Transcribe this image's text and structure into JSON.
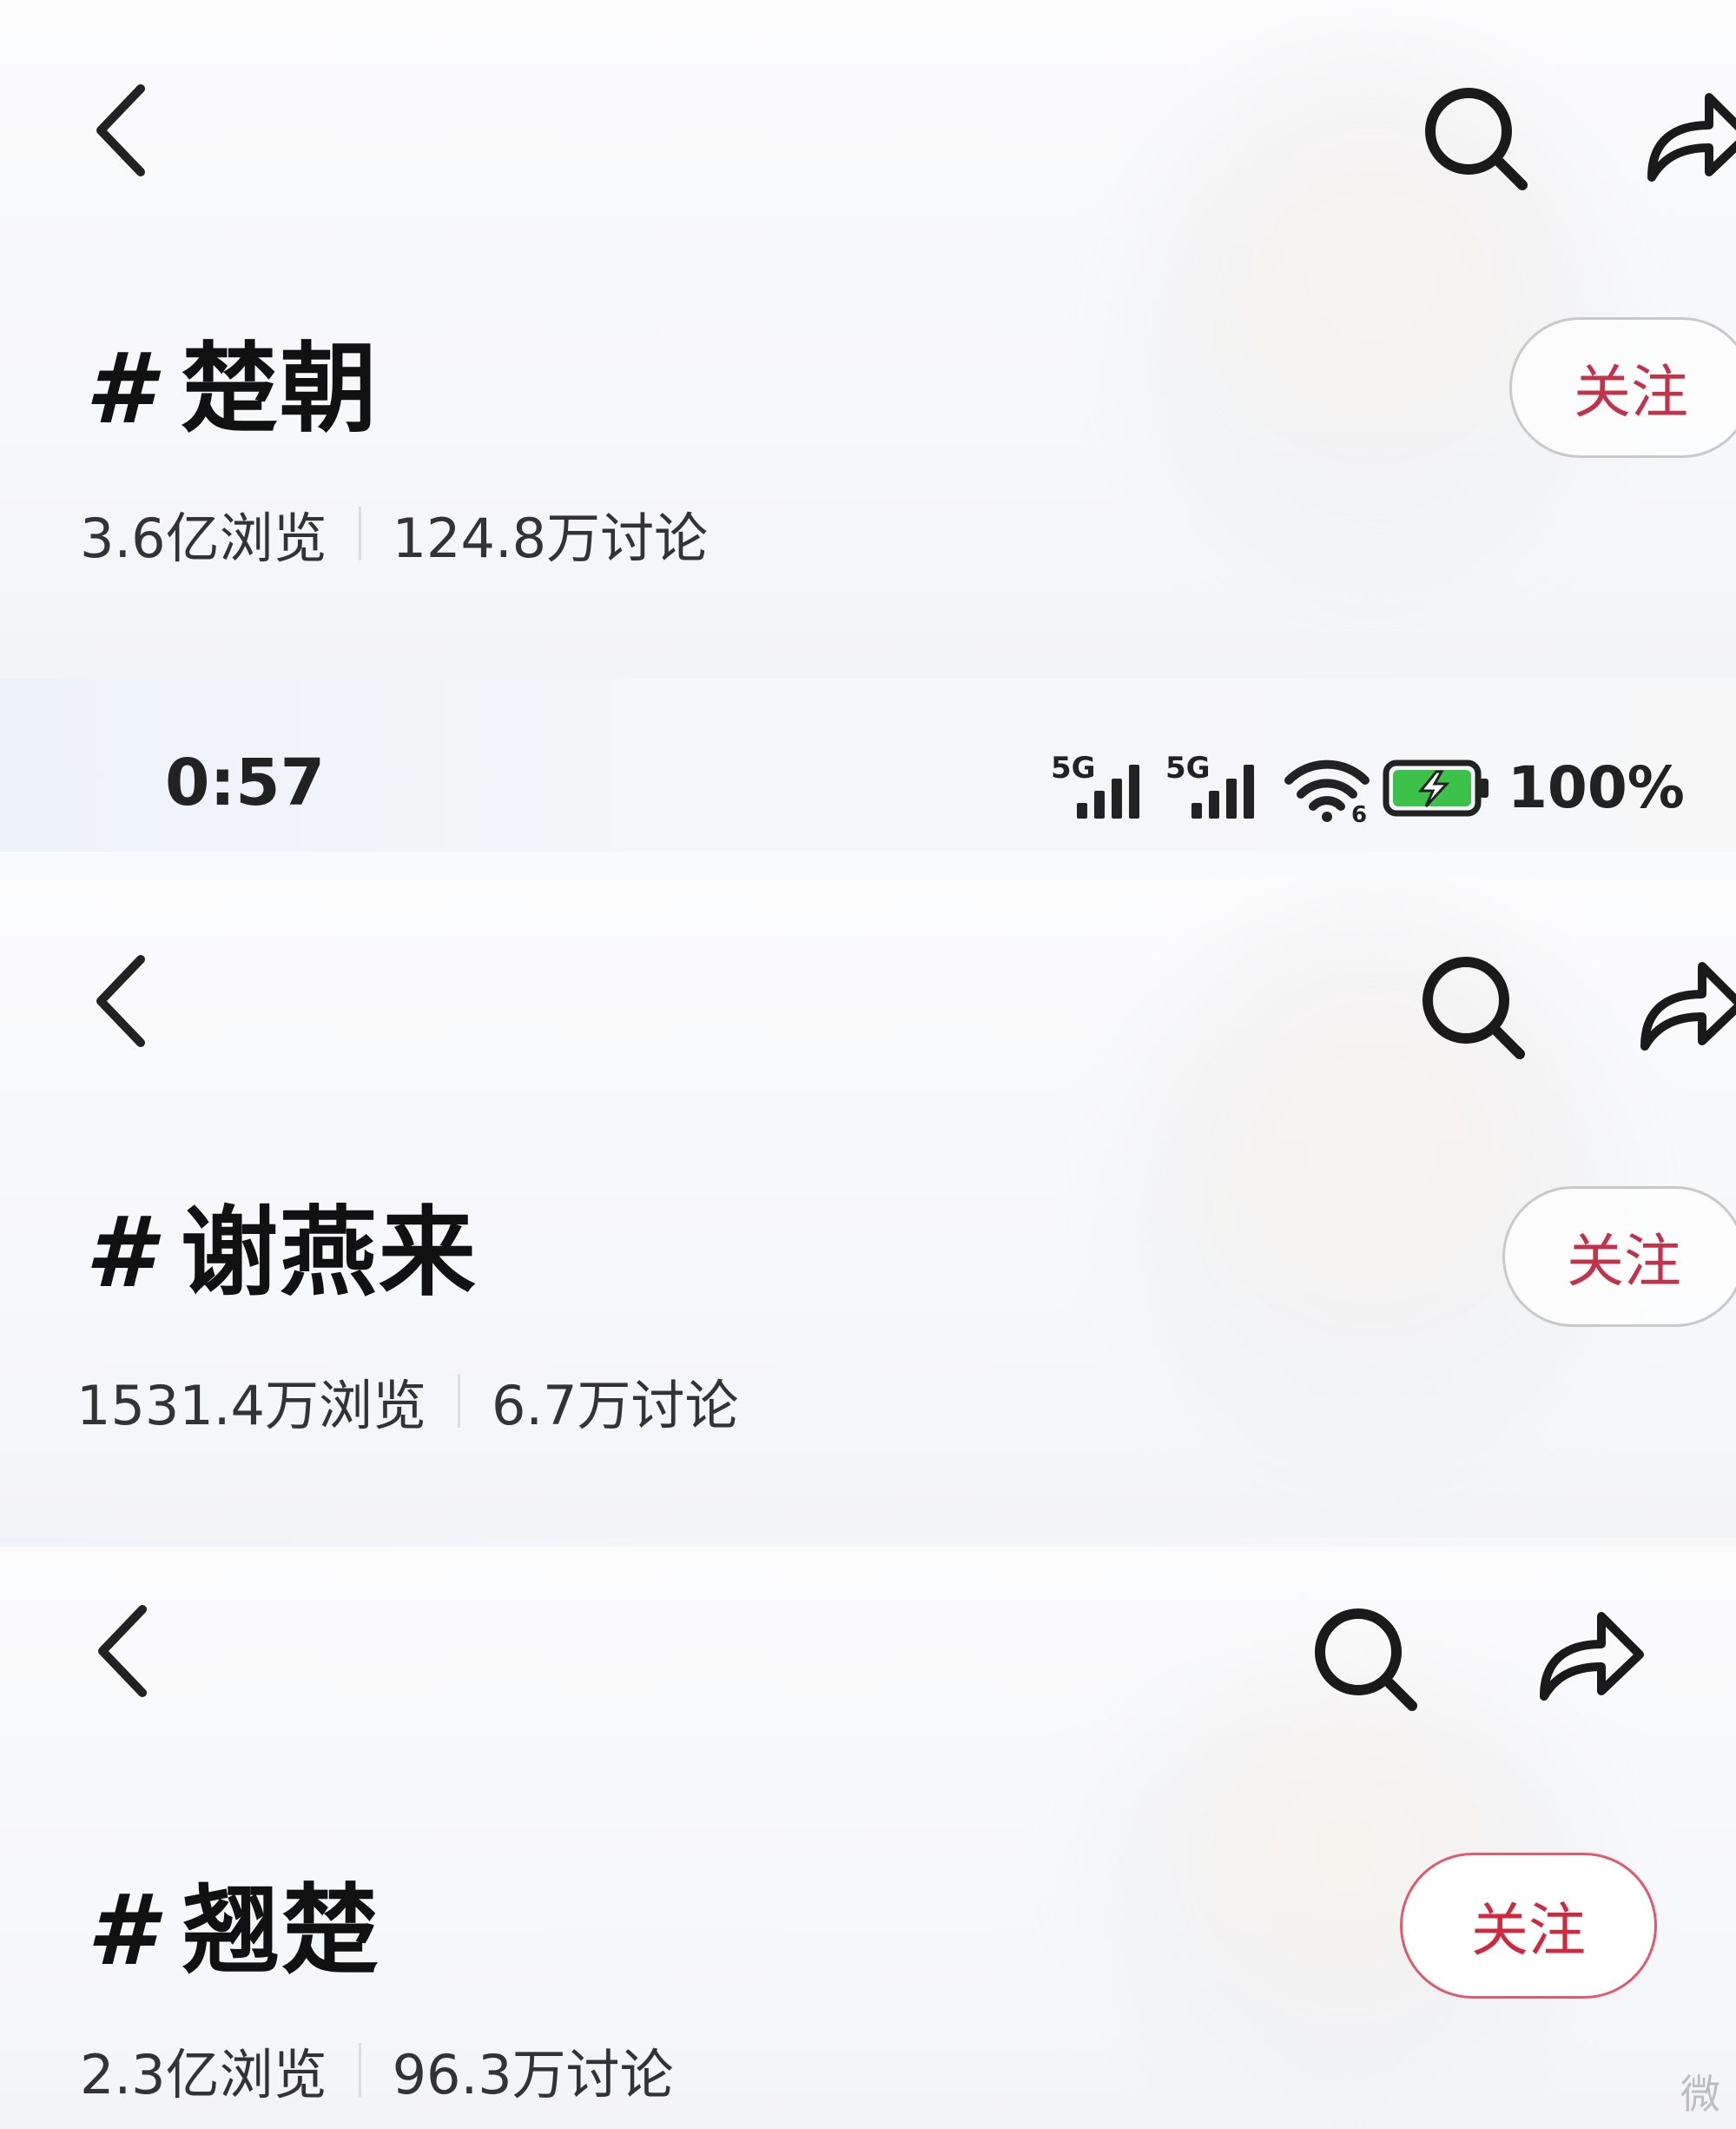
{
  "panels": [
    {
      "hashtag_symbol": "#",
      "title": "楚朝",
      "views": "3.6亿浏览",
      "discussions": "124.8万讨论",
      "follow_label": "关注"
    },
    {
      "hashtag_symbol": "#",
      "title": "谢燕来",
      "views": "1531.4万浏览",
      "discussions": "6.7万讨论",
      "follow_label": "关注"
    },
    {
      "hashtag_symbol": "#",
      "title": "翘楚",
      "views": "2.3亿浏览",
      "discussions": "96.3万讨论",
      "follow_label": "关注"
    }
  ],
  "status_bar": {
    "time": "0:57",
    "sim1_network": "5G",
    "sim2_network": "5G",
    "wifi_badge": "6",
    "battery_percent": "100%"
  },
  "icons": {
    "back": "chevron-left-icon",
    "search": "search-icon",
    "share": "share-arrow-icon"
  },
  "colors": {
    "follow_text": "#c2334b",
    "follow_active_border": "#e05a6c",
    "battery_fill": "#3cc24a",
    "text_primary": "#111111"
  },
  "watermark": "微"
}
